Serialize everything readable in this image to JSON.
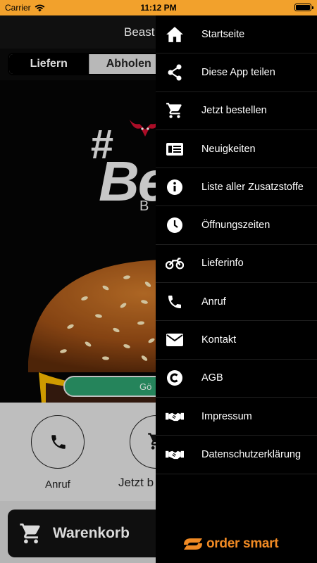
{
  "status_bar": {
    "carrier": "Carrier",
    "time": "11:12 PM"
  },
  "header": {
    "title": "Beast"
  },
  "order_type": {
    "options": [
      "Liefern",
      "Abholen"
    ],
    "selected": "Liefern"
  },
  "hero": {
    "logo_hash": "#",
    "logo_word": "Be",
    "logo_sub": "B",
    "open_status": "Gö"
  },
  "actions": [
    {
      "label": "Anruf",
      "icon": "phone-icon"
    },
    {
      "label": "Jetzt b",
      "icon": "cart-icon"
    }
  ],
  "cart": {
    "label": "Warenkorb"
  },
  "drawer": {
    "items": [
      {
        "label": "Startseite",
        "icon": "home-icon"
      },
      {
        "label": "Diese App teilen",
        "icon": "share-icon"
      },
      {
        "label": "Jetzt bestellen",
        "icon": "cart-icon"
      },
      {
        "label": "Neuigkeiten",
        "icon": "news-icon"
      },
      {
        "label": "Liste aller Zusatzstoffe",
        "icon": "info-icon"
      },
      {
        "label": "Öffnungszeiten",
        "icon": "clock-icon"
      },
      {
        "label": "Lieferinfo",
        "icon": "motorbike-icon"
      },
      {
        "label": "Anruf",
        "icon": "phone-icon"
      },
      {
        "label": "Kontakt",
        "icon": "mail-icon"
      },
      {
        "label": "AGB",
        "icon": "copyright-icon"
      },
      {
        "label": "Impressum",
        "icon": "handshake-icon"
      },
      {
        "label": "Datenschutzerklärung",
        "icon": "handshake-icon"
      }
    ],
    "brand": "order smart"
  },
  "colors": {
    "status_bar": "#f2a12c",
    "drawer_bg": "#000000",
    "brand": "#f08a24",
    "open_pill": "#2c9a6a"
  }
}
